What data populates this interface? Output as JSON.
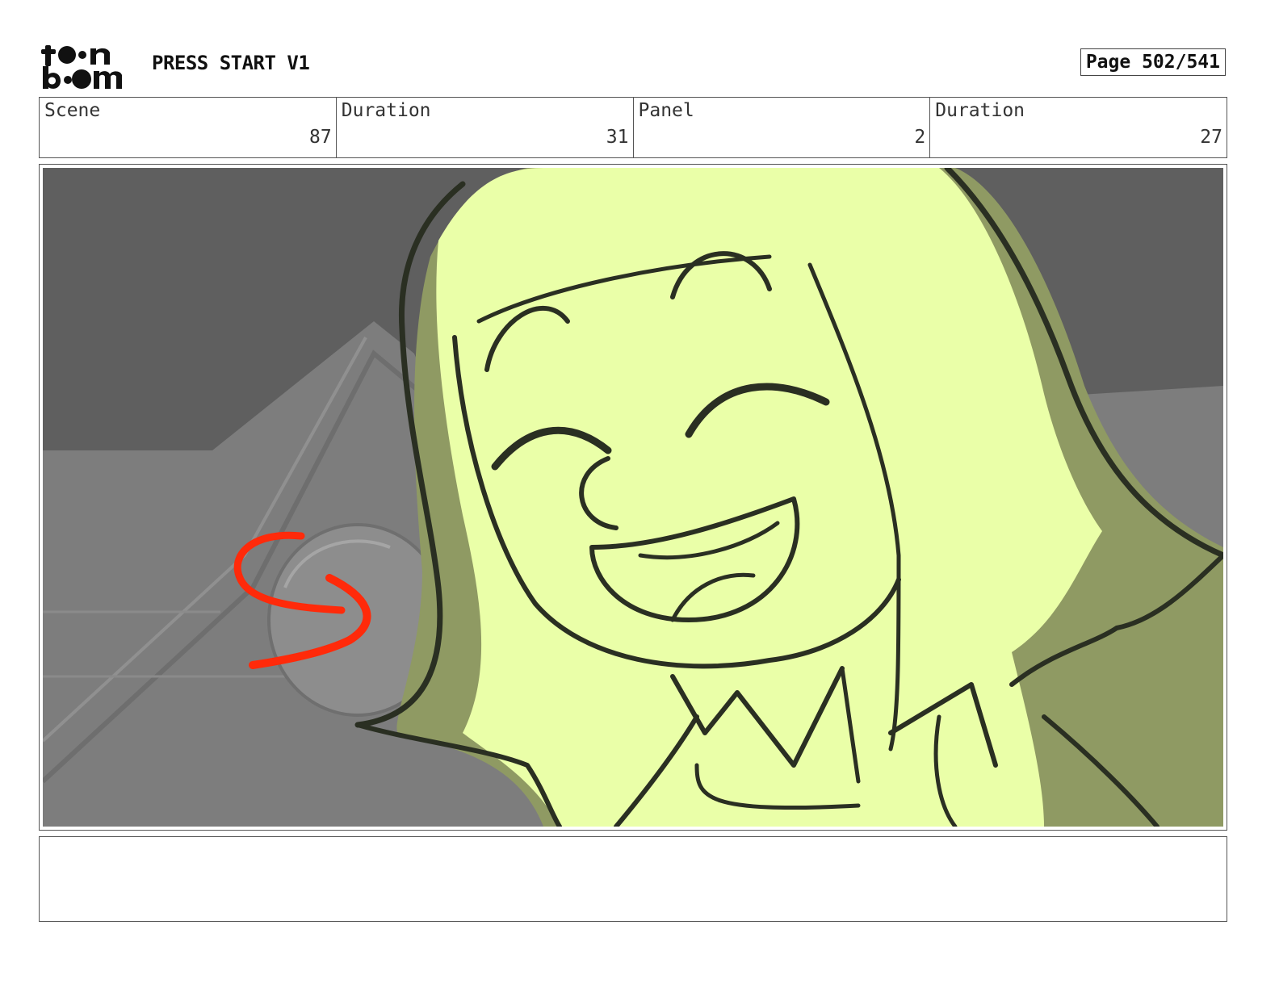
{
  "header": {
    "logo_text": "toon boom",
    "project_title": "PRESS START V1",
    "page_label": "Page 502/541"
  },
  "info": [
    {
      "label": "Scene",
      "value": "87"
    },
    {
      "label": "Duration",
      "value": "31"
    },
    {
      "label": "Panel",
      "value": "2"
    },
    {
      "label": "Duration",
      "value": "27"
    }
  ],
  "panel": {
    "description": "",
    "colors": {
      "background_dark": "#5f5f5f",
      "background_mid": "#7c7c7c",
      "character_fill": "#eaffa8",
      "hair_shadow": "#8f9a63",
      "line_ink": "#2a2f22",
      "arrow_red": "#ff2a0a"
    }
  },
  "notes": {
    "text": ""
  }
}
